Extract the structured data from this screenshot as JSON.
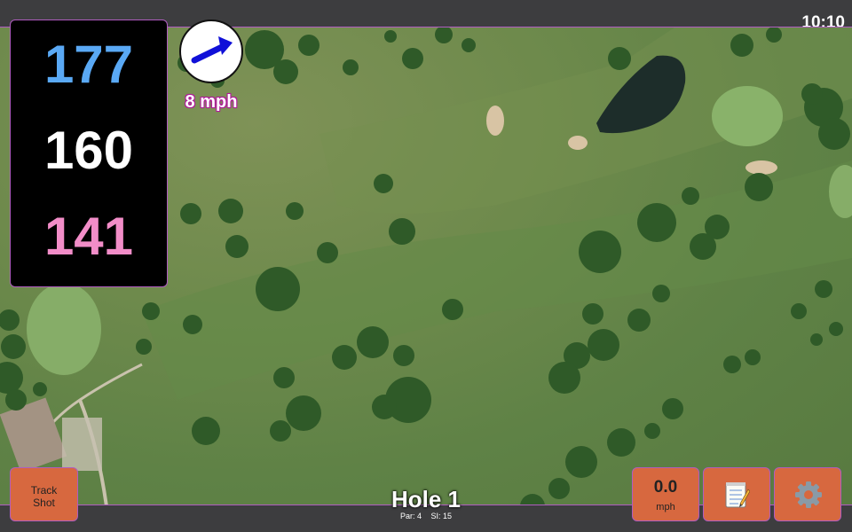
{
  "status": {
    "time": "10:10"
  },
  "distances": {
    "back": "177",
    "middle": "160",
    "front": "141"
  },
  "wind": {
    "speed_label": "8 mph",
    "direction_icon": "arrow-icon"
  },
  "buttons": {
    "track_shot_line1": "Track",
    "track_shot_line2": "Shot",
    "speed_value": "0.0",
    "speed_unit": "mph",
    "notes_icon": "notepad-icon",
    "settings_icon": "gear-icon"
  },
  "hole": {
    "title": "Hole 1",
    "par": "Par: 4",
    "si": "SI: 15"
  },
  "colors": {
    "back": "#5aa9f5",
    "middle": "#ffffff",
    "front": "#f28dc8",
    "button": "#d7683f",
    "accent_border": "#b05cc0",
    "wind_arrow": "#1010d8"
  }
}
